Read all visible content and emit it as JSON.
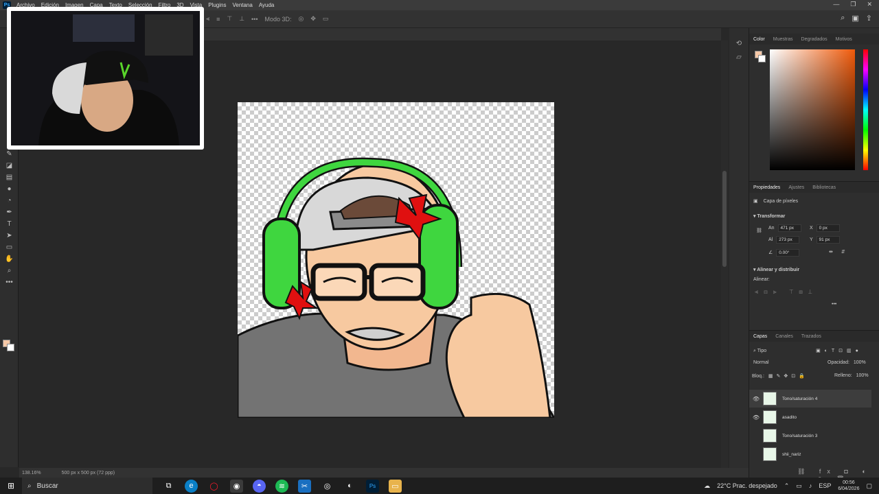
{
  "menubar": {
    "app_logo": "Ps",
    "items": [
      "Archivo",
      "Edición",
      "Imagen",
      "Capa",
      "Texto",
      "Selección",
      "Filtro",
      "3D",
      "Vista",
      "Plugins",
      "Ventana",
      "Ayuda"
    ],
    "window_controls": [
      "—",
      "❐",
      "✕"
    ]
  },
  "optbar": {
    "mode_label": "Modo 3D:"
  },
  "status": {
    "zoom": "138.16%",
    "doc_info": "500 px x 500 px (72 ppp)"
  },
  "color_panel": {
    "tabs": [
      "Color",
      "Muestras",
      "Degradados",
      "Motivos"
    ],
    "active_tab": "Color",
    "foreground": "#f7c9a8",
    "background": "#ffffff"
  },
  "properties_panel": {
    "tabs": [
      "Propiedades",
      "Ajustes",
      "Bibliotecas"
    ],
    "active_tab": "Propiedades",
    "layer_kind": "Capa de píxeles",
    "transform_title": "Transformar",
    "width_label": "An",
    "width_value": "471 px",
    "height_label": "Al",
    "height_value": "273 px",
    "x_label": "X",
    "x_value": "0 px",
    "y_label": "Y",
    "y_value": "91 px",
    "angle_value": "0.00°",
    "align_title": "Alinear y distribuir",
    "align_label": "Alinear:"
  },
  "layers_panel": {
    "tabs": [
      "Capas",
      "Canales",
      "Trazados"
    ],
    "active_tab": "Capas",
    "filter_label": "Tipo",
    "blend_mode": "Normal",
    "opacity_label": "Opacidad:",
    "opacity_value": "100%",
    "lock_label": "Bloq.:",
    "fill_label": "Relleno:",
    "fill_value": "100%",
    "layers": [
      {
        "name": "Tono/saturación 4",
        "visible": true,
        "selected": true
      },
      {
        "name": "asadito",
        "visible": true,
        "selected": false
      },
      {
        "name": "Tono/saturación 3",
        "visible": false,
        "selected": false
      },
      {
        "name": "shii_nariz",
        "visible": false,
        "selected": false
      }
    ]
  },
  "taskbar": {
    "search_placeholder": "Buscar",
    "weather": "22°C Prac. despejado",
    "language": "ESP",
    "time": "00:56",
    "date": "6/04/2026"
  }
}
